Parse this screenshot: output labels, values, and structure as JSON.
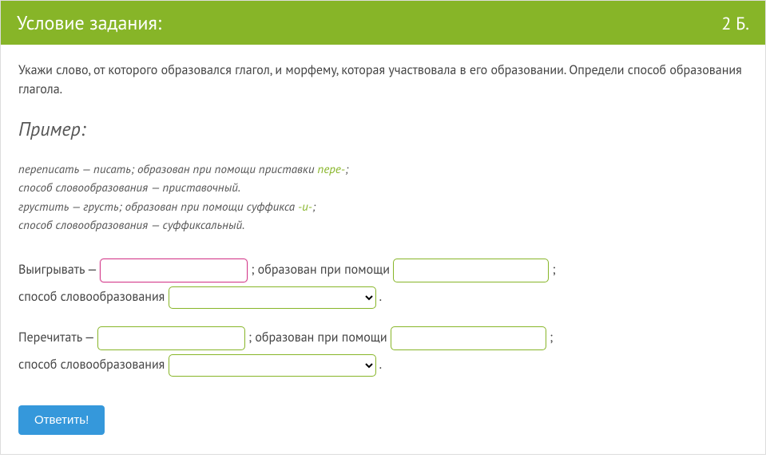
{
  "header": {
    "title": "Условие задания:",
    "points": "2 Б."
  },
  "task": "Укажи слово, от которого образовался глагол, и морфему, которая участвовала в его образовании. Определи способ образования глагола.",
  "example_heading": "Пример:",
  "example": {
    "line1a": "переписать — писать; образован при помощи приставки ",
    "line1hl": "пере-",
    "line1b": ";",
    "line2": "способ словообразования — приставочный.",
    "line3a": "грустить — грусть; образован при помощи суффикса ",
    "line3hl": "-и-",
    "line3b": ";",
    "line4": "способ словообразования — суффиксальный."
  },
  "q1": {
    "word": "Выигрывать",
    "dash": " — ",
    "mid": "; образован при помощи ",
    "end": " ;",
    "method_label": "способ словообразования ",
    "period": "."
  },
  "q2": {
    "word": "Перечитать",
    "dash": " — ",
    "mid": "; образован при помощи ",
    "end": " ;",
    "method_label": "способ словообразования ",
    "period": "."
  },
  "submit": "Ответить!"
}
